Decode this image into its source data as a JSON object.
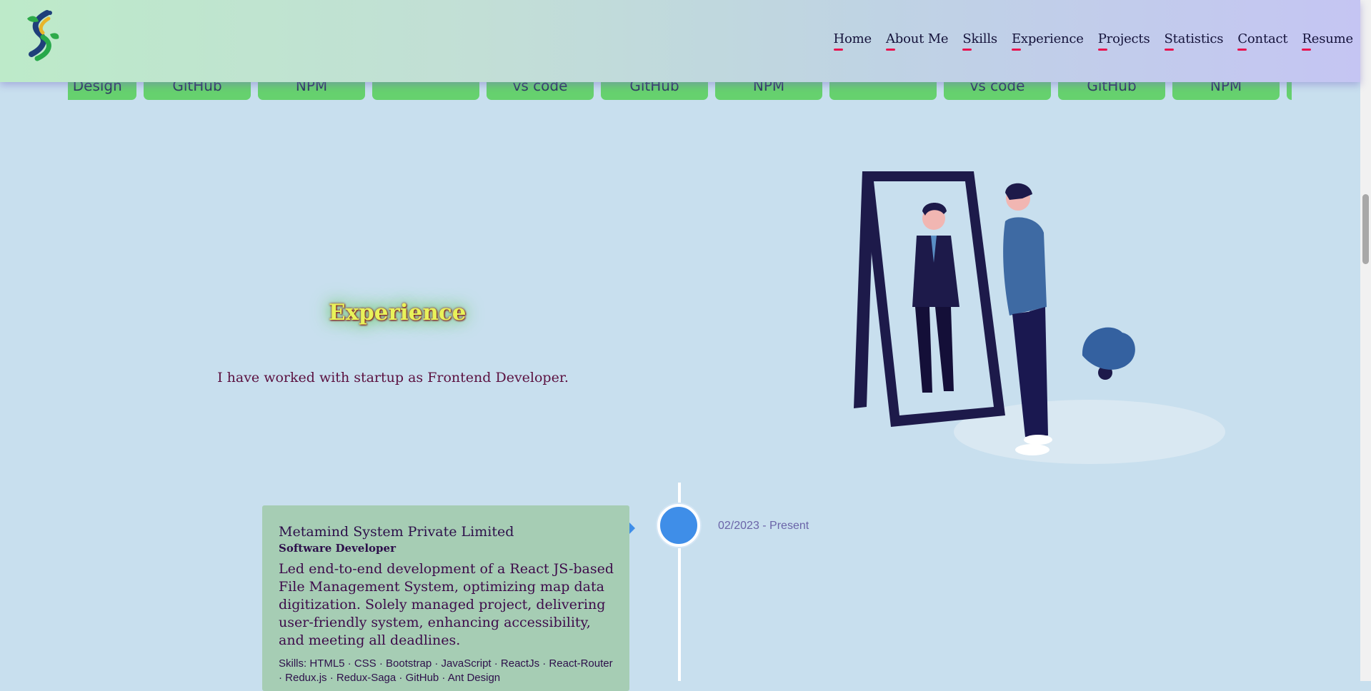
{
  "nav": {
    "items": [
      {
        "label": "Home"
      },
      {
        "label": "About Me"
      },
      {
        "label": "Skills"
      },
      {
        "label": "Experience"
      },
      {
        "label": "Projects"
      },
      {
        "label": "Statistics"
      },
      {
        "label": "Contact"
      },
      {
        "label": "Resume"
      }
    ],
    "accent_color": "#e8124e"
  },
  "skills_marquee": {
    "chips": [
      "Ant Design",
      "GitHub",
      "NPM",
      "",
      "vs code",
      "GitHub",
      "NPM",
      "",
      "vs code",
      "GitHub",
      "NPM",
      ""
    ],
    "chip_color": "#66d16e"
  },
  "experience": {
    "title": "Experience",
    "subtitle": "I have worked with startup as Frontend Developer."
  },
  "timeline": [
    {
      "company": "Metamind System Private Limited",
      "role": "Software Developer",
      "date": "02/2023 - Present",
      "description": "Led end-to-end development of a React JS-based File Management System, optimizing map data digitization. Solely managed project, delivering user-friendly system, enhancing accessibility, and meeting all deadlines.",
      "skills": "Skills: HTML5 · CSS · Bootstrap · JavaScript · ReactJs · React-Router · Redux.js · Redux-Saga · GitHub · Ant Design"
    }
  ],
  "icons": {
    "logo": "leaf-helix-logo-icon",
    "illustration": "man-looking-in-mirror-illustration",
    "timeline_marker": "timeline-dot-icon"
  }
}
